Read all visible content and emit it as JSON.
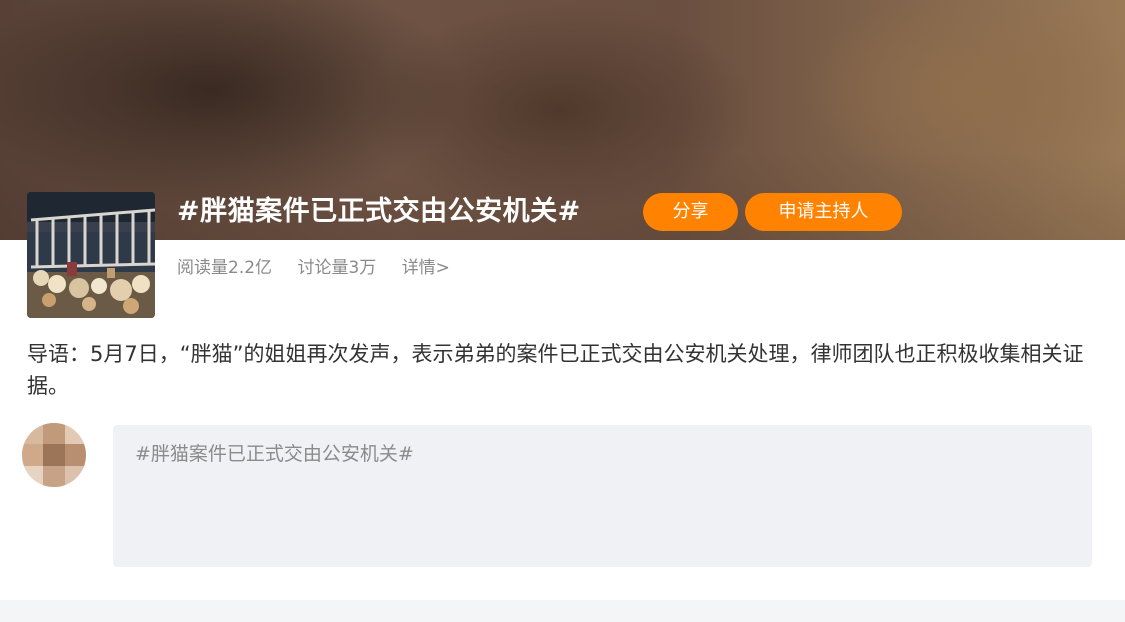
{
  "topic": {
    "title": "#胖猫案件已正式交由公安机关#",
    "share_label": "分享",
    "apply_host_label": "申请主持人"
  },
  "stats": {
    "reads": "阅读量2.2亿",
    "discussions": "讨论量3万",
    "details_link": "详情>"
  },
  "intro": {
    "text": "导语：5月7日，“胖猫”的姐姐再次发声，表示弟弟的案件已正式交由公安机关处理，律师团队也正积极收集相关证据。"
  },
  "compose": {
    "placeholder": "#胖猫案件已正式交由公安机关#"
  },
  "colors": {
    "accent": "#ff8200",
    "compose_bg": "#eff1f5"
  },
  "icons": {
    "avatar": "blurred-user-avatar",
    "thumbnail": "topic-cover-photo"
  }
}
